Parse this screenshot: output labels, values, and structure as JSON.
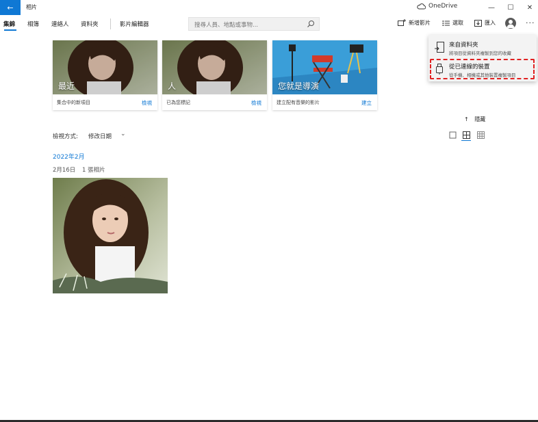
{
  "titlebar": {
    "app_title": "相片",
    "onedrive_label": "OneDrive",
    "back_glyph": "←",
    "minimize_glyph": "—",
    "maximize_glyph": "☐",
    "close_glyph": "✕"
  },
  "nav": {
    "items": [
      {
        "label": "集錦",
        "active": true
      },
      {
        "label": "相簿"
      },
      {
        "label": "連絡人"
      },
      {
        "label": "資料夾"
      },
      {
        "label": "影片編輯器"
      }
    ]
  },
  "search": {
    "placeholder": "搜尋人員、地點或事物..."
  },
  "toolbar": {
    "new_video_label": "新增影片",
    "select_label": "選取",
    "import_label": "匯入",
    "more_glyph": "···"
  },
  "albums": [
    {
      "title": "最近",
      "subtitle": "集合中的新項目",
      "action": "檢視"
    },
    {
      "title": "人",
      "subtitle": "已為您標記",
      "action": "檢視"
    },
    {
      "title": "您就是導演",
      "subtitle": "建立配有音樂的影片",
      "action": "建立"
    }
  ],
  "hide_label": "隱藏",
  "hide_arrow": "↑",
  "view_by": {
    "label": "檢視方式:",
    "value": "修改日期",
    "chevron": "⌄"
  },
  "timeline": {
    "month": "2022年2月",
    "date": "2月16日",
    "count": "1 張相片"
  },
  "import_menu": {
    "items": [
      {
        "title": "來自資料夾",
        "desc": "將項目從資料夾複製到您的收藏"
      },
      {
        "title": "從已連線的裝置",
        "desc": "從手機、相機或其他裝置複製項目"
      }
    ]
  },
  "colors": {
    "accent": "#0f78d4",
    "highlight": "#e02020"
  }
}
